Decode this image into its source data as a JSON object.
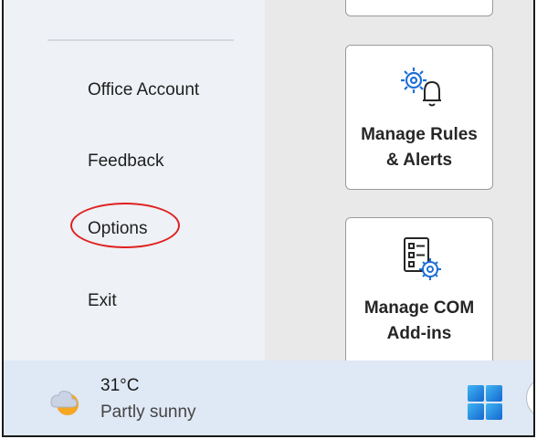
{
  "menu": {
    "items": [
      {
        "label": "Office Account"
      },
      {
        "label": "Feedback"
      },
      {
        "label": "Options"
      },
      {
        "label": "Exit"
      }
    ]
  },
  "tiles": [
    {
      "line1": "Manage Rules",
      "line2": "& Alerts",
      "icon": "gear-bell-icon"
    },
    {
      "line1": "Manage COM",
      "line2": "Add-ins",
      "icon": "list-gear-icon"
    }
  ],
  "taskbar": {
    "temperature": "31°C",
    "condition": "Partly sunny",
    "weather_icon": "partly-sunny-icon",
    "start_icon": "windows-start-icon"
  },
  "colors": {
    "highlight_circle": "#e0201f",
    "accent_blue": "#1f6fd6"
  }
}
